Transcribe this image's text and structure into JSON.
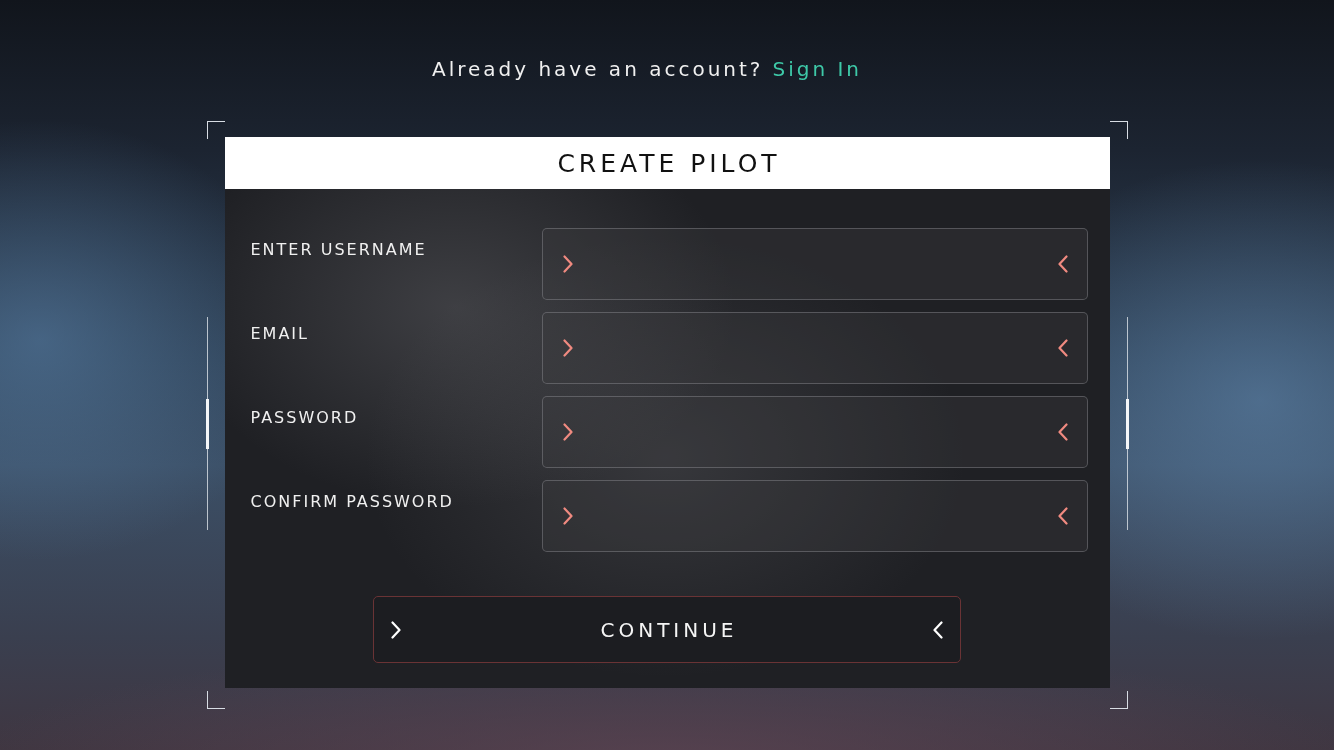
{
  "prompt": {
    "text": "Already have an account?",
    "link": "Sign In"
  },
  "panel": {
    "title": "CREATE PILOT"
  },
  "fields": [
    {
      "label": "ENTER USERNAME"
    },
    {
      "label": "EMAIL"
    },
    {
      "label": "PASSWORD"
    },
    {
      "label": "CONFIRM PASSWORD"
    }
  ],
  "continue_button": {
    "label": "CONTINUE"
  }
}
